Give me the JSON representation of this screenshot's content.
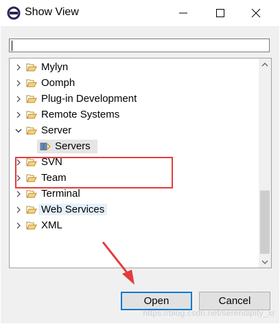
{
  "window": {
    "title": "Show View"
  },
  "filter": {
    "value": ""
  },
  "tree": {
    "items": [
      {
        "label": "Mylyn",
        "expanded": false
      },
      {
        "label": "Oomph",
        "expanded": false
      },
      {
        "label": "Plug-in Development",
        "expanded": false
      },
      {
        "label": "Remote Systems",
        "expanded": false
      },
      {
        "label": "Server",
        "expanded": true,
        "children": [
          {
            "label": "Servers",
            "selected": true
          }
        ]
      },
      {
        "label": "SVN",
        "expanded": false
      },
      {
        "label": "Team",
        "expanded": false
      },
      {
        "label": "Terminal",
        "expanded": false
      },
      {
        "label": "Web Services",
        "expanded": false,
        "hovered": true
      },
      {
        "label": "XML",
        "expanded": false
      }
    ]
  },
  "buttons": {
    "open": "Open",
    "cancel": "Cancel"
  },
  "watermark": "https://blog.csdn.net/serendipity_xr",
  "colors": {
    "annotation_red": "#e43b3b",
    "default_button_border": "#0078d7",
    "selection_bg": "#e5e5e5",
    "hover_bg": "#e5f1fb"
  },
  "icons": {
    "app": "eclipse-icon",
    "folder": "folder-open-icon",
    "servers_view": "servers-view-icon"
  }
}
